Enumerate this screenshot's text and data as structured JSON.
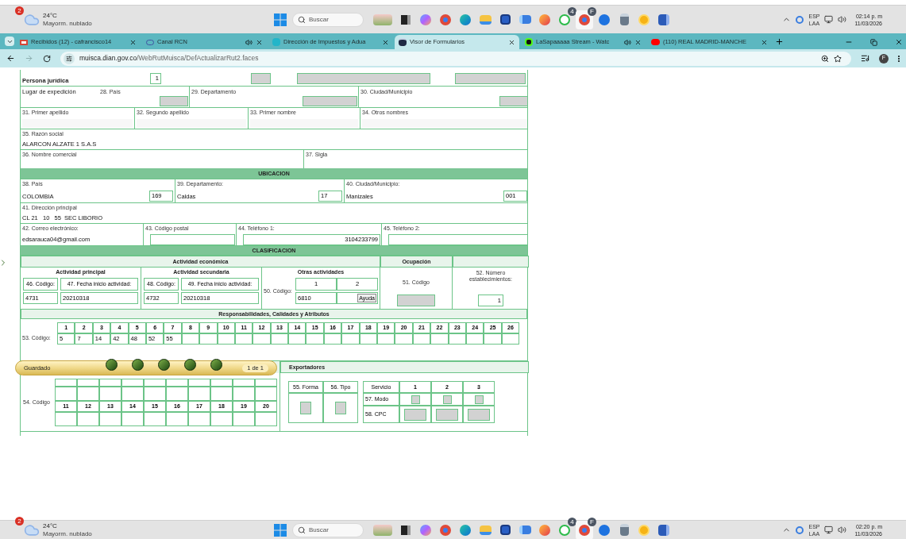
{
  "taskbar_top": {
    "weather": {
      "temp": "24°C",
      "condition": "Mayorm. nublado",
      "badge": "2"
    },
    "search": {
      "placeholder": "Buscar"
    },
    "apps": [
      {
        "kind": "art",
        "selected": false
      },
      {
        "kind": "taskview",
        "selected": false
      },
      {
        "kind": "copilot",
        "selected": false
      },
      {
        "kind": "chrome",
        "selected": false
      },
      {
        "kind": "edge",
        "selected": false
      },
      {
        "kind": "folder",
        "selected": false
      },
      {
        "kind": "store",
        "selected": false
      },
      {
        "kind": "mail",
        "selected": false
      },
      {
        "kind": "firefox",
        "selected": false
      },
      {
        "kind": "whatsapp",
        "selected": false,
        "badge": "4"
      },
      {
        "kind": "chrome",
        "selected": true,
        "badge": "F"
      },
      {
        "kind": "stocks",
        "selected": false
      },
      {
        "kind": "calculator",
        "selected": false
      },
      {
        "kind": "sun",
        "selected": false
      },
      {
        "kind": "word",
        "selected": false
      }
    ],
    "tray": {
      "lang": "ESP",
      "region": "LAA",
      "time": "02:14 p. m",
      "date": "11/03/2026"
    }
  },
  "browser": {
    "tabs": [
      {
        "title": "Recibidos (12) - cafrancisco14",
        "kind": "mail",
        "audio": false,
        "selected": false
      },
      {
        "title": "Canal RCN",
        "kind": "tv",
        "audio": true,
        "selected": false
      },
      {
        "title": "Dirección de Impuestos y Adua",
        "kind": "site",
        "audio": false,
        "selected": false
      },
      {
        "title": "Visor de Formularios",
        "kind": "doc",
        "audio": false,
        "selected": true
      },
      {
        "title": "LaSapaaaaa Stream - Watc",
        "kind": "stream",
        "audio": true,
        "selected": false
      },
      {
        "title": "(110) REAL MADRID-MANCHE",
        "kind": "video",
        "audio": false,
        "selected": false
      }
    ],
    "address": {
      "host": "muisca.dian.gov.co",
      "path": "/WebRutMuisca/DefActualizarRut2.faces"
    },
    "profile": "F"
  },
  "form": {
    "persona": {
      "label": "Persona jurídica",
      "value": "1"
    },
    "expedition": {
      "label": "Lugar de expedición",
      "fields": [
        {
          "label": "28. País"
        },
        {
          "label": "29. Departamento"
        },
        {
          "label": "30. Ciudad/Municipio"
        }
      ]
    },
    "names": [
      {
        "label": "31. Primer apellido"
      },
      {
        "label": "32. Segundo apellido"
      },
      {
        "label": "33. Primer nombre"
      },
      {
        "label": "34. Otros nombres"
      }
    ],
    "razon_social": {
      "label": "35. Razón social",
      "value": "ALARCON ALZATE 1 S.A.S"
    },
    "commercial": [
      {
        "label": "36. Nombre comercial"
      },
      {
        "label": "37. Sigla"
      }
    ],
    "ubicacion": {
      "title": "UBICACION",
      "place": [
        {
          "label": "38. País",
          "value": "COLOMBIA",
          "code": "169"
        },
        {
          "label": "39. Departamento:",
          "value": "Caldas",
          "code": "17"
        },
        {
          "label": "40. Ciudad/Municipio:",
          "value": "Manizales",
          "code": "001"
        }
      ],
      "address": {
        "label": "41. Dirección principal",
        "value": "CL 21   10   55  SEC LIBORIO"
      },
      "contact": [
        {
          "label": "42. Correo electrónico:",
          "value": "edsarauca04@gmail.com",
          "boxed": false
        },
        {
          "label": "43. Código postal",
          "boxed": true
        },
        {
          "label": "44. Teléfono 1:",
          "value": "3104233799",
          "boxed": true
        },
        {
          "label": "45. Teléfono 2:",
          "boxed": true
        }
      ]
    },
    "clasificacion": {
      "title": "CLASIFICACION",
      "economic_title": "Actividad económica",
      "occupation_title": "Ocupación",
      "activities": [
        {
          "title": "Actividad principal",
          "code_label": "46. Código:",
          "date_label": "47. Fecha inicio actividad:",
          "code": "4731",
          "date": "20210318"
        },
        {
          "title": "Actividad secundaria",
          "code_label": "48. Código:",
          "date_label": "49. Fecha inicio actividad:",
          "code": "4732",
          "date": "20210318"
        }
      ],
      "others": {
        "title": "Otras actividades",
        "code_label": "50. Código:",
        "columns": [
          "1",
          "2"
        ],
        "code": "6810",
        "help": "Ayuda"
      },
      "occupation_code_label": "51. Código",
      "establishments_label": "52. Número establecimientos:",
      "establishments": "1"
    },
    "responsabilidades": {
      "title": "Responsabilidades, Calidades y Atributos",
      "code_label": "53. Código:",
      "columns": [
        "1",
        "2",
        "3",
        "4",
        "5",
        "6",
        "7",
        "8",
        "9",
        "10",
        "11",
        "12",
        "13",
        "14",
        "15",
        "16",
        "17",
        "18",
        "19",
        "20",
        "21",
        "22",
        "23",
        "24",
        "25",
        "26"
      ],
      "values": [
        "5",
        "7",
        "14",
        "42",
        "48",
        "52",
        "55"
      ]
    },
    "aduanas": {
      "code_label": "54. Código",
      "columns": [
        "11",
        "12",
        "13",
        "14",
        "15",
        "16",
        "17",
        "18",
        "19",
        "20"
      ]
    },
    "exportadores": {
      "title": "Exportadores",
      "form_label": "55. Forma",
      "type_label": "56. Tipo",
      "service_label": "Servicio",
      "columns": [
        "1",
        "2",
        "3"
      ],
      "mode_label": "57. Modo",
      "cpc_label": "58. CPC"
    }
  },
  "toolbar": {
    "status": "Guardado",
    "page": "1 de 1"
  },
  "taskbar_bottom": {
    "weather": {
      "temp": "24°C",
      "condition": "Mayorm. nublado",
      "badge": "2"
    },
    "search": {
      "placeholder": "Buscar"
    },
    "apps": [
      {
        "kind": "art",
        "selected": false
      },
      {
        "kind": "taskview",
        "selected": false
      },
      {
        "kind": "copilot",
        "selected": false
      },
      {
        "kind": "chrome",
        "selected": false
      },
      {
        "kind": "edge",
        "selected": false
      },
      {
        "kind": "folder",
        "selected": false
      },
      {
        "kind": "store",
        "selected": false
      },
      {
        "kind": "mail",
        "selected": false
      },
      {
        "kind": "firefox",
        "selected": false
      },
      {
        "kind": "whatsapp",
        "selected": false,
        "badge": "4"
      },
      {
        "kind": "chrome",
        "selected": true,
        "badge": "F"
      },
      {
        "kind": "stocks",
        "selected": false
      },
      {
        "kind": "calculator",
        "selected": false
      },
      {
        "kind": "sun",
        "selected": false
      },
      {
        "kind": "word",
        "selected": false
      }
    ],
    "tray": {
      "lang": "ESP",
      "region": "LAA",
      "time": "02:20 p. m",
      "date": "11/03/2026"
    }
  }
}
